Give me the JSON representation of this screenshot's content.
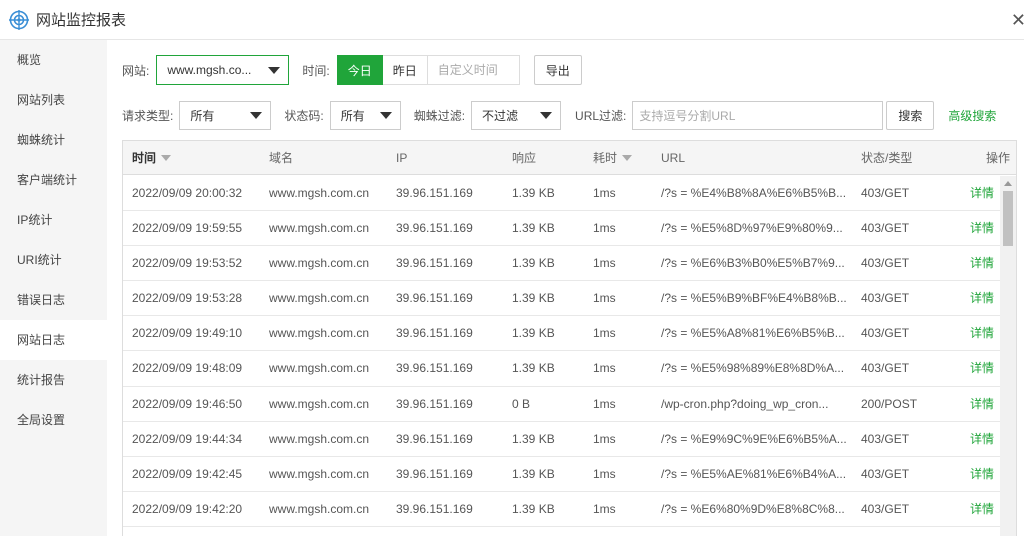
{
  "window": {
    "title": "网站监控报表",
    "close_glyph": "✕",
    "logo_icon": "target-logo-icon",
    "accent": "#20a53a"
  },
  "sidebar": {
    "items": [
      {
        "label": "概览",
        "active": false
      },
      {
        "label": "网站列表",
        "active": false
      },
      {
        "label": "蜘蛛统计",
        "active": false
      },
      {
        "label": "客户端统计",
        "active": false
      },
      {
        "label": "IP统计",
        "active": false
      },
      {
        "label": "URI统计",
        "active": false
      },
      {
        "label": "错误日志",
        "active": false
      },
      {
        "label": "网站日志",
        "active": true
      },
      {
        "label": "统计报告",
        "active": false
      },
      {
        "label": "全局设置",
        "active": false
      }
    ]
  },
  "filters": {
    "site_label": "网站:",
    "site_value": "www.mgsh.co...",
    "time_label": "时间:",
    "time_today": "今日",
    "time_yesterday": "昨日",
    "time_custom_placeholder": "自定义时间",
    "export_label": "导出",
    "req_type_label": "请求类型:",
    "req_type_value": "所有",
    "status_label": "状态码:",
    "status_value": "所有",
    "spider_label": "蜘蛛过滤:",
    "spider_value": "不过滤",
    "url_label": "URL过滤:",
    "url_placeholder": "支持逗号分割URL",
    "search_label": "搜索",
    "advanced_label": "高级搜索"
  },
  "table": {
    "headers": {
      "time": "时间",
      "domain": "域名",
      "ip": "IP",
      "response": "响应",
      "elapsed": "耗时",
      "url": "URL",
      "status": "状态/类型",
      "action": "操作"
    },
    "rows": [
      {
        "time": "2022/09/09 20:00:32",
        "domain": "www.mgsh.com.cn",
        "ip": "39.96.151.169",
        "response": "1.39 KB",
        "elapsed": "1ms",
        "url": "/?s = %E4%B8%8A%E6%B5%B...",
        "status": "403/GET",
        "action": "详情"
      },
      {
        "time": "2022/09/09 19:59:55",
        "domain": "www.mgsh.com.cn",
        "ip": "39.96.151.169",
        "response": "1.39 KB",
        "elapsed": "1ms",
        "url": "/?s = %E5%8D%97%E9%80%9...",
        "status": "403/GET",
        "action": "详情"
      },
      {
        "time": "2022/09/09 19:53:52",
        "domain": "www.mgsh.com.cn",
        "ip": "39.96.151.169",
        "response": "1.39 KB",
        "elapsed": "1ms",
        "url": "/?s = %E6%B3%B0%E5%B7%9...",
        "status": "403/GET",
        "action": "详情"
      },
      {
        "time": "2022/09/09 19:53:28",
        "domain": "www.mgsh.com.cn",
        "ip": "39.96.151.169",
        "response": "1.39 KB",
        "elapsed": "1ms",
        "url": "/?s = %E5%B9%BF%E4%B8%B...",
        "status": "403/GET",
        "action": "详情"
      },
      {
        "time": "2022/09/09 19:49:10",
        "domain": "www.mgsh.com.cn",
        "ip": "39.96.151.169",
        "response": "1.39 KB",
        "elapsed": "1ms",
        "url": "/?s = %E5%A8%81%E6%B5%B...",
        "status": "403/GET",
        "action": "详情"
      },
      {
        "time": "2022/09/09 19:48:09",
        "domain": "www.mgsh.com.cn",
        "ip": "39.96.151.169",
        "response": "1.39 KB",
        "elapsed": "1ms",
        "url": "/?s = %E5%98%89%E8%8D%A...",
        "status": "403/GET",
        "action": "详情"
      },
      {
        "time": "2022/09/09 19:46:50",
        "domain": "www.mgsh.com.cn",
        "ip": "39.96.151.169",
        "response": "0 B",
        "elapsed": "1ms",
        "url": "/wp-cron.php?doing_wp_cron...",
        "status": "200/POST",
        "action": "详情"
      },
      {
        "time": "2022/09/09 19:44:34",
        "domain": "www.mgsh.com.cn",
        "ip": "39.96.151.169",
        "response": "1.39 KB",
        "elapsed": "1ms",
        "url": "/?s = %E9%9C%9E%E6%B5%A...",
        "status": "403/GET",
        "action": "详情"
      },
      {
        "time": "2022/09/09 19:42:45",
        "domain": "www.mgsh.com.cn",
        "ip": "39.96.151.169",
        "response": "1.39 KB",
        "elapsed": "1ms",
        "url": "/?s = %E5%AE%81%E6%B4%A...",
        "status": "403/GET",
        "action": "详情"
      },
      {
        "time": "2022/09/09 19:42:20",
        "domain": "www.mgsh.com.cn",
        "ip": "39.96.151.169",
        "response": "1.39 KB",
        "elapsed": "1ms",
        "url": "/?s = %E6%80%9D%E8%8C%8...",
        "status": "403/GET",
        "action": "详情"
      }
    ]
  }
}
